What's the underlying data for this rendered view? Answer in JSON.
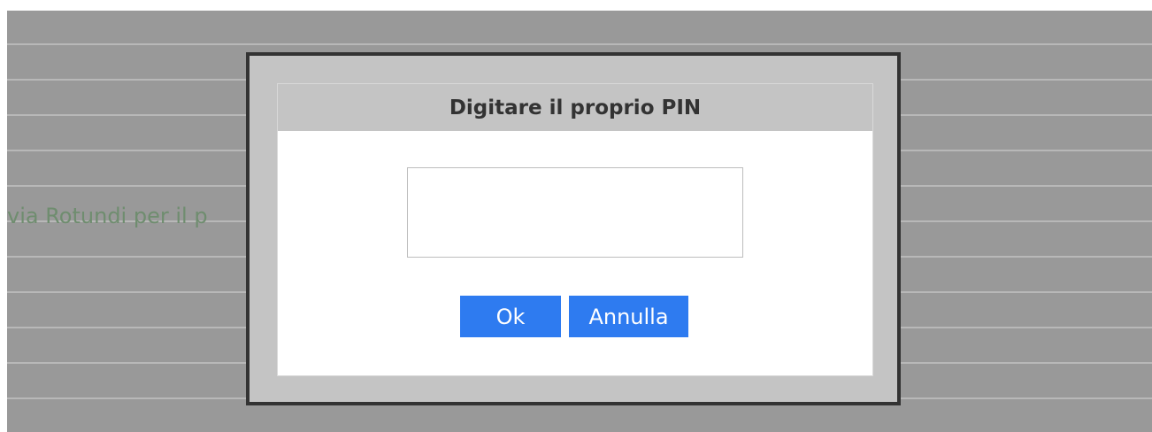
{
  "background": {
    "partial_text": "via Rotundi per il p"
  },
  "dialog": {
    "title": "Digitare il proprio PIN",
    "pin_input": {
      "value": "",
      "placeholder": ""
    },
    "ok_label": "Ok",
    "cancel_label": "Annulla"
  },
  "colors": {
    "overlay": "#999999",
    "frame_border": "#333333",
    "header_bg": "#c4c4c4",
    "button_bg": "#2e7bf0",
    "button_text": "#ffffff",
    "background_text": "#6f8d6f"
  }
}
